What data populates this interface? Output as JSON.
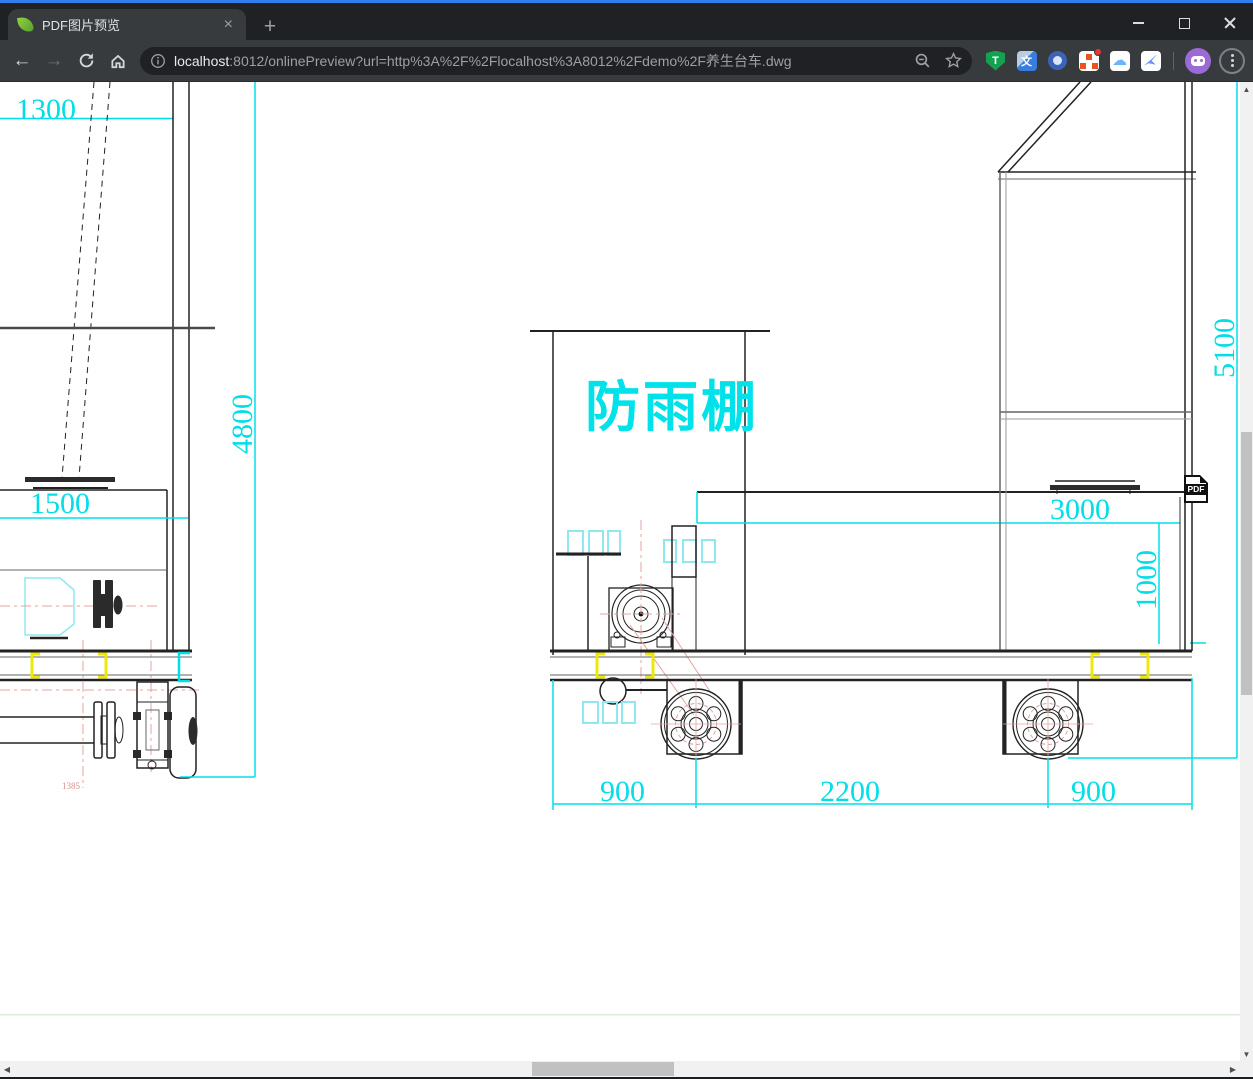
{
  "browser": {
    "tab_title": "PDF图片预览",
    "url_host": "localhost",
    "url_rest": ":8012/onlinePreview?url=http%3A%2F%2Flocalhost%3A8012%2Fdemo%2F养生台车.dwg"
  },
  "icons": {
    "new_tab": "+",
    "tab_close": "×",
    "cloud": "☁",
    "scroll_up": "▲",
    "scroll_down": "▼",
    "scroll_left": "◀",
    "scroll_right": "▶"
  },
  "extensions": {
    "tampermonkey_letter": "T",
    "translate_glyph": "文"
  },
  "viewer": {
    "pdf_badge": "PDF",
    "shelter_label": "防雨棚",
    "dims": {
      "left_top": "1300",
      "left_height": "4800",
      "left_width": "1500",
      "left_axle": "1385",
      "bed_length": "3000",
      "bed_height": "1000",
      "right_height": "5100",
      "front": "900",
      "wheelbase": "2200",
      "rear": "900"
    },
    "colors": {
      "dimension_cyan": "#00dfe8",
      "highlight_yellow": "#ece80a"
    }
  }
}
